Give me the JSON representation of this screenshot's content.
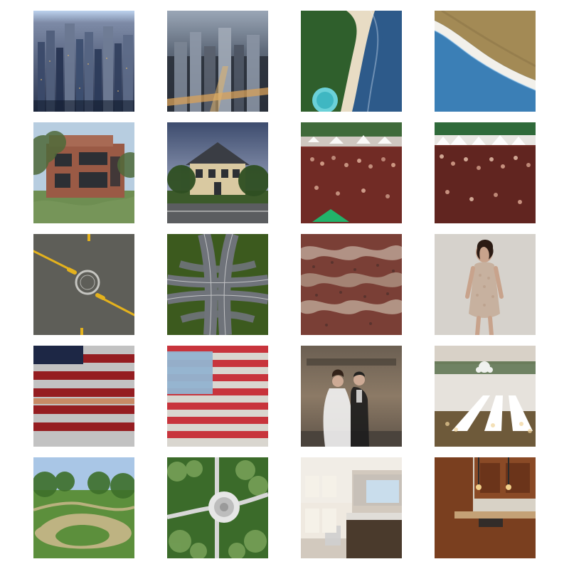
{
  "grid": {
    "rows": 5,
    "columns": 4,
    "images": [
      {
        "id": "r1c1",
        "subject": "city-skyline-aerial",
        "palette": [
          "#2a3550",
          "#8a93a6",
          "#c9a76a"
        ]
      },
      {
        "id": "r1c2",
        "subject": "city-downtown-aerial",
        "palette": [
          "#1f2630",
          "#7d8796",
          "#d9a25a"
        ]
      },
      {
        "id": "r1c3",
        "subject": "coastline-beach-aerial",
        "palette": [
          "#2f5f2c",
          "#e8dcc4",
          "#2d5a8a"
        ]
      },
      {
        "id": "r1c4",
        "subject": "coastline-shore-aerial",
        "palette": [
          "#a38a55",
          "#f2f0ea",
          "#3b7fb6"
        ]
      },
      {
        "id": "r2c1",
        "subject": "modern-brick-house",
        "palette": [
          "#9a5a45",
          "#6e8e52",
          "#b7cde0"
        ]
      },
      {
        "id": "r2c2",
        "subject": "classic-villa-house",
        "palette": [
          "#d9c9a1",
          "#3c5a2a",
          "#7f8aa6"
        ]
      },
      {
        "id": "r2c3",
        "subject": "festival-crowd",
        "palette": [
          "#7c2f2a",
          "#3f6a3a",
          "#cfc7c0"
        ]
      },
      {
        "id": "r2c4",
        "subject": "festival-crowd",
        "palette": [
          "#6d2a24",
          "#2f6a3a",
          "#ffffff"
        ]
      },
      {
        "id": "r3c1",
        "subject": "roundabout-aerial",
        "palette": [
          "#5e5e58",
          "#e4b21d",
          "#d0d0cc"
        ]
      },
      {
        "id": "r3c2",
        "subject": "highway-interchange-aerial",
        "palette": [
          "#3c5a1e",
          "#6f737a",
          "#e4e4e4"
        ]
      },
      {
        "id": "r3c3",
        "subject": "patterned-fabric",
        "palette": [
          "#7a3f36",
          "#c9b7a6",
          "#4a2e2a"
        ]
      },
      {
        "id": "r3c4",
        "subject": "woman-in-dress",
        "palette": [
          "#d9d6d0",
          "#c7b19f",
          "#6a4d3b"
        ]
      },
      {
        "id": "r4c1",
        "subject": "american-flag",
        "palette": [
          "#1f2a4a",
          "#9f1f24",
          "#cfcfcf"
        ]
      },
      {
        "id": "r4c2",
        "subject": "american-flag",
        "palette": [
          "#7fa7c7",
          "#c8343c",
          "#d9d6cf"
        ]
      },
      {
        "id": "r4c3",
        "subject": "wedding-couple",
        "palette": [
          "#8c7a66",
          "#1d1d1d",
          "#f2f2f2"
        ]
      },
      {
        "id": "r4c4",
        "subject": "banquet-hall",
        "palette": [
          "#e6e2dc",
          "#6e5a3a",
          "#ffffff"
        ]
      },
      {
        "id": "r5c1",
        "subject": "park-trail",
        "palette": [
          "#5c8f3c",
          "#c9b78a",
          "#a9c6e6"
        ]
      },
      {
        "id": "r5c2",
        "subject": "park-plaza-aerial",
        "palette": [
          "#3b6b2a",
          "#d7d7d7",
          "#7aa35a"
        ]
      },
      {
        "id": "r5c3",
        "subject": "white-kitchen",
        "palette": [
          "#f1ede6",
          "#4a3a2c",
          "#d2c9be"
        ]
      },
      {
        "id": "r5c4",
        "subject": "wood-kitchen",
        "palette": [
          "#7a3f1f",
          "#c4a176",
          "#d8d2c6"
        ]
      }
    ]
  }
}
